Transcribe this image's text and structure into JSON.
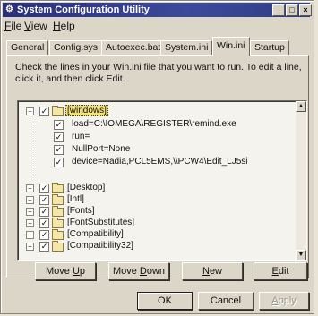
{
  "window": {
    "title": "System Configuration Utility",
    "minimize": "_",
    "maximize": "□",
    "close": "×"
  },
  "menu": [
    {
      "label_pre": "",
      "label_u": "F",
      "label_post": "ile"
    },
    {
      "label_pre": "",
      "label_u": "V",
      "label_post": "iew"
    },
    {
      "label_pre": "",
      "label_u": "H",
      "label_post": "elp"
    }
  ],
  "tabs": [
    "General",
    "Config.sys",
    "Autoexec.bat",
    "System.ini",
    "Win.ini",
    "Startup"
  ],
  "active_tab": "Win.ini",
  "instructions": "Check the lines in your Win.ini file that you want to run. To edit a line, click it, and then click Edit.",
  "tree": {
    "root": {
      "label": "[windows]",
      "checked": true,
      "expanded": true
    },
    "children": [
      {
        "label": "load=C:\\IOMEGA\\REGISTER\\remind.exe",
        "checked": true
      },
      {
        "label": "run=",
        "checked": true
      },
      {
        "label": "NullPort=None",
        "checked": true
      },
      {
        "label": "device=Nadia,PCL5EMS,\\\\PCW4\\Edit_LJ5si",
        "checked": true
      }
    ],
    "sections": [
      {
        "label": "[Desktop]",
        "checked": true
      },
      {
        "label": "[Intl]",
        "checked": true
      },
      {
        "label": "[Fonts]",
        "checked": true
      },
      {
        "label": "[FontSubstitutes]",
        "checked": true
      },
      {
        "label": "[Compatibility]",
        "checked": true
      },
      {
        "label": "[Compatibility32]",
        "checked": true
      }
    ],
    "expand_symbol": "+",
    "collapse_symbol": "−",
    "check_mark": "✓"
  },
  "buttons": {
    "move_up": {
      "pre": "Move ",
      "u": "U",
      "post": "p"
    },
    "move_down": {
      "pre": "Move ",
      "u": "D",
      "post": "own"
    },
    "new": {
      "pre": "",
      "u": "N",
      "post": "ew"
    },
    "edit": {
      "pre": "",
      "u": "E",
      "post": "dit"
    },
    "ok": "OK",
    "cancel": "Cancel",
    "apply": {
      "pre": "",
      "u": "A",
      "post": "pply"
    }
  }
}
